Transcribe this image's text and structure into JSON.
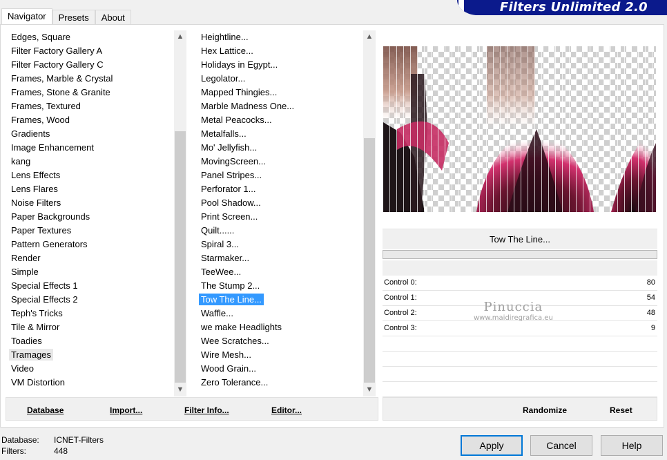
{
  "tabs": [
    "Navigator",
    "Presets",
    "About"
  ],
  "banner_title": "Filters Unlimited 2.0",
  "categories": [
    "Edges, Square",
    "Filter Factory Gallery A",
    "Filter Factory Gallery C",
    "Frames, Marble & Crystal",
    "Frames, Stone & Granite",
    "Frames, Textured",
    "Frames, Wood",
    "Gradients",
    "Image Enhancement",
    "kang",
    "Lens Effects",
    "Lens Flares",
    "Noise Filters",
    "Paper Backgrounds",
    "Paper Textures",
    "Pattern Generators",
    "Render",
    "Simple",
    "Special Effects 1",
    "Special Effects 2",
    "Teph's Tricks",
    "Tile & Mirror",
    "Toadies",
    "Tramages",
    "Video",
    "VM Distortion"
  ],
  "selected_category": "Tramages",
  "filters": [
    "Heightline...",
    "Hex Lattice...",
    "Holidays in Egypt...",
    "Legolator...",
    "Mapped Thingies...",
    "Marble Madness One...",
    "Metal Peacocks...",
    "Metalfalls...",
    "Mo' Jellyfish...",
    "MovingScreen...",
    "Panel Stripes...",
    "Perforator 1...",
    "Pool Shadow...",
    "Print Screen...",
    "Quilt......",
    "Spiral 3...",
    "Starmaker...",
    "TeeWee...",
    "The Stump 2...",
    "Tow The Line...",
    "Waffle...",
    "we make Headlights",
    "Wee Scratches...",
    "Wire Mesh...",
    "Wood Grain...",
    "Zero Tolerance..."
  ],
  "selected_filter": "Tow The Line...",
  "left_buttons": {
    "database": "Database",
    "import": "Import...",
    "filter_info": "Filter Info...",
    "editor": "Editor..."
  },
  "right_buttons": {
    "randomize": "Randomize",
    "reset": "Reset"
  },
  "filter_name": "Tow The Line...",
  "controls": [
    {
      "label": "Control 0:",
      "value": "80"
    },
    {
      "label": "Control 1:",
      "value": "54"
    },
    {
      "label": "Control 2:",
      "value": "48"
    },
    {
      "label": "Control 3:",
      "value": "9"
    }
  ],
  "watermark": {
    "name": "Pinuccia",
    "site": "www.maidiregrafica.eu"
  },
  "status": {
    "database_label": "Database:",
    "database_value": "ICNET-Filters",
    "filters_label": "Filters:",
    "filters_value": "448"
  },
  "dialog_buttons": {
    "apply": "Apply",
    "cancel": "Cancel",
    "help": "Help"
  },
  "colors": {
    "selection": "#3399ff",
    "banner": "#0b1a8c",
    "preview_pink": "#d2326e"
  }
}
